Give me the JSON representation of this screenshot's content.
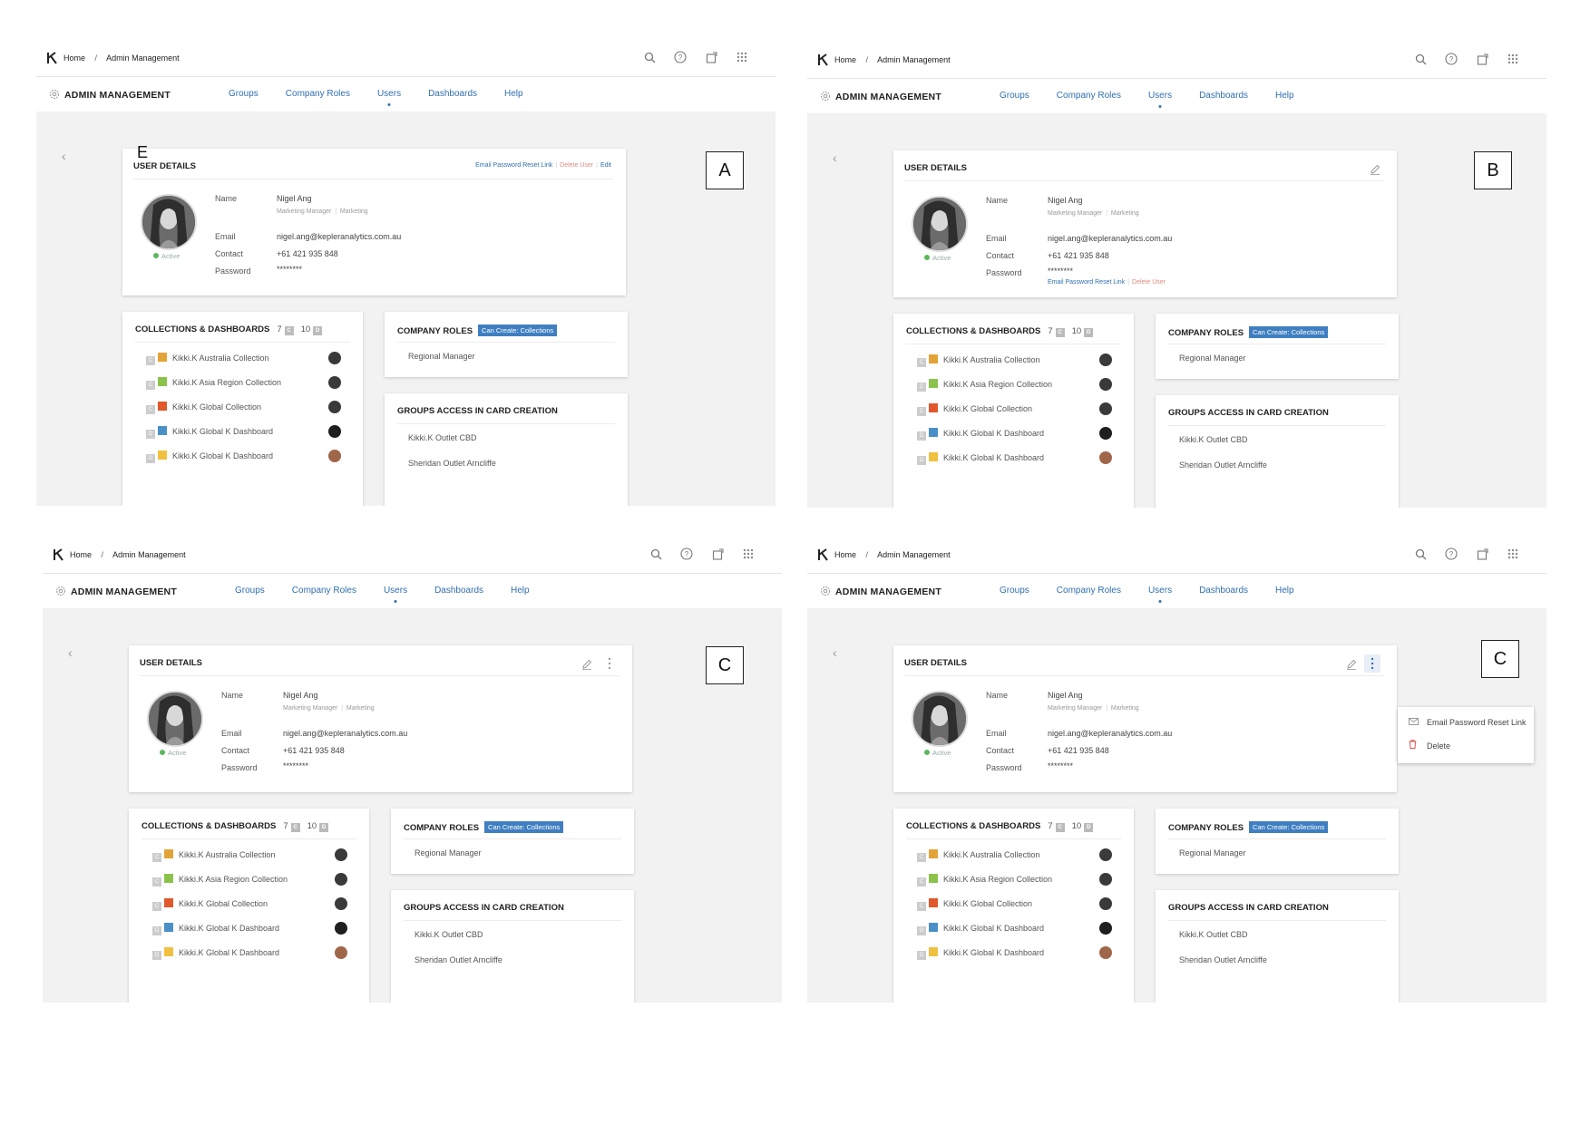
{
  "breadcrumb": {
    "home": "Home",
    "sep": "/",
    "current": "Admin Management"
  },
  "nav": {
    "title": "ADMIN MANAGEMENT",
    "tabs": [
      "Groups",
      "Company Roles",
      "Users",
      "Dashboards",
      "Help"
    ]
  },
  "user_details": {
    "title": "USER DETAILS",
    "status": "Active",
    "labels": {
      "name": "Name",
      "email": "Email",
      "contact": "Contact",
      "password": "Password"
    },
    "name": "Nigel Ang",
    "role": "Marketing Manager",
    "dept": "Marketing",
    "email": "nigel.ang@kepleranalytics.com.au",
    "contact": "+61 421 935 848",
    "password": "********",
    "reset_link": "Email Password Reset Link",
    "delete_user": "Delete User",
    "edit": "Edit",
    "sep": "|"
  },
  "collections": {
    "title": "COLLECTIONS & DASHBOARDS",
    "c_count": "7",
    "c_badge": "C",
    "d_count": "10",
    "d_badge": "D",
    "items": [
      {
        "type": "C",
        "label": "Kikki.K Australia Collection",
        "color": "#e3a437"
      },
      {
        "type": "C",
        "label": "Kikki.K Asia Region Collection",
        "color": "#8bc34a"
      },
      {
        "type": "C",
        "label": "Kikki.K Global Collection",
        "color": "#e0582b"
      },
      {
        "type": "D",
        "label": "Kikki.K Global K Dashboard",
        "color": "#4a90c8",
        "tag": "DS"
      },
      {
        "type": "D",
        "label": "Kikki.K Global K Dashboard",
        "color": "#f0c040",
        "tag": "DS"
      }
    ]
  },
  "company_roles": {
    "title": "COMPANY ROLES",
    "badge": "Can Create: Collections",
    "item": "Regional Manager"
  },
  "groups_access": {
    "title": "GROUPS ACCESS IN CARD CREATION",
    "items": [
      "Kikki.K Outlet CBD",
      "Sheridan Outlet Arncliffe"
    ]
  },
  "menu": {
    "reset": "Email Password Reset Link",
    "delete": "Delete"
  },
  "annotations": {
    "a": "A",
    "b": "B",
    "c1": "C",
    "c2": "C",
    "e": "E"
  },
  "colors": {
    "accent": "#2f6fb2",
    "danger": "#e08b80",
    "badge": "#3f7fc1",
    "active": "#5cb85c",
    "canvas": "#f2f2f2"
  },
  "icons": [
    "search-icon",
    "help-icon",
    "share-icon",
    "apps-grid-icon",
    "gear-icon",
    "back-chevron-icon",
    "edit-pencil-icon",
    "more-vertical-icon",
    "mail-icon",
    "trash-icon"
  ]
}
